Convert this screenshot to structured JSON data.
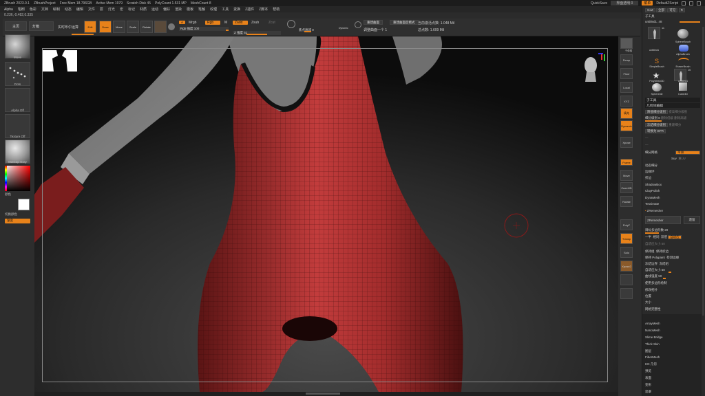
{
  "titlebar": {
    "app": "ZBrush 2023.0.1",
    "project": "ZBrushProject",
    "free_mem": "Free Mem 18.796GB",
    "active_mem": "Active Mem 1979",
    "scratch_disk": "Scratch Disk 45",
    "poly_count": "PolyCount 1.531 MP",
    "mesh_count": "MeshCount 8",
    "quicksave": "QuickSave",
    "transparency": "界面透明 0",
    "menus_btn": "菜单",
    "default_script": "DefaultZScript"
  },
  "menubar": {
    "items": [
      "Alpha",
      "笔刷",
      "色彩",
      "文档",
      "绘制",
      "动态",
      "编辑",
      "文件",
      "层",
      "灯光",
      "宏",
      "标记",
      "材质",
      "运动",
      "偏好",
      "渲染",
      "模板",
      "笔触",
      "纹理",
      "工具",
      "变换",
      "Z插件",
      "Z脚本",
      "帮助"
    ]
  },
  "infobar": {
    "text": "0.236,-0.482,0.335"
  },
  "shelf": {
    "home": "主页",
    "lightbox": "灯箱",
    "liveboolean": "实时布尔运算",
    "edit_label": "Edit",
    "draw_label": "Draw",
    "move_label": "Move",
    "scale_label": "Scale",
    "rotate_label": "Rotate",
    "a_label": "A",
    "mrgb_label": "Mrgb",
    "rgb_label": "Rgb",
    "m_label": "M",
    "zadd_label": "Zadd",
    "zsub_label": "Zsub",
    "zcut_label": "Zcut",
    "rgb_intensity": "Rgb 强度 100",
    "z_intensity": "Z 强度 51",
    "focal_shift": "焦点衰减 0",
    "draw_size": "绘制大小 8.42419",
    "dynamic": "Dynamic",
    "active_points": "当前激活点数: 1.048 Mil",
    "total_points": "总点数: 1.609 Mil",
    "curve_label": "重建曲面",
    "curve_label2": "重建曲面后模式",
    "adjust_label": "调整曲面一个 1"
  },
  "leftpanel": {
    "brush_name": "Move",
    "stroke_name": "Dots",
    "alpha_name": "Alpha Off",
    "texture_name": "Texture Off",
    "material_name": "MatCap Gray",
    "color_label": "颜色",
    "switch_color": "切换颜色",
    "gradient": "渐变"
  },
  "rightcol": {
    "items": [
      "子像素",
      "Persp",
      "Floor",
      "Local",
      "XYZ",
      "填充",
      "Dynamic",
      "Xpose",
      "Frame",
      "Move",
      "Zoom3D",
      "Rotate",
      "PolyF",
      "Transp",
      "Solo",
      "Xpose2"
    ]
  },
  "toolpanel": {
    "goz": "GoZ",
    "all": "全部",
    "visible": "可见",
    "r": "R",
    "subtool_label": "子工具",
    "current_tool": "untitled1. 48",
    "brushes": [
      {
        "name": "untitled1",
        "badge": "11"
      },
      {
        "name": "SphereBrush",
        "badge": ""
      },
      {
        "name": "AlphaBrush",
        "badge": ""
      },
      {
        "name": "SimpleBrush",
        "badge": ""
      },
      {
        "name": "EraserBrush",
        "badge": ""
      },
      {
        "name": "PolyMesh3D",
        "badge": ""
      },
      {
        "name": "untitled1",
        "badge": "16"
      },
      {
        "name": "Sphere3D",
        "badge": ""
      },
      {
        "name": "Cube3D",
        "badge": ""
      }
    ],
    "section_subtool": "子工具",
    "section_geometry": "几何体编辑",
    "divide_lower": "降低细分级别",
    "divide_higher": "提高细分级别",
    "sdiv": "细分级别 8",
    "del_lower": "删除低级",
    "del_higher": "删除高级",
    "freeze": "冻结细分级别",
    "reconstruct": "重建细分",
    "convert_bpr": "转换为 BPR",
    "divide_btn": "细分网格",
    "smt": "平滑",
    "suv": "Suv",
    "reuv": "重UV",
    "dynamic_sub": "动态细分",
    "edge_loop": "边缘环",
    "crease": "折边",
    "shadowbox": "ShadowBox",
    "claypolish": "ClayPolish",
    "dynamesh": "DynaMesh",
    "tessimate": "Tessimate",
    "zremesher": "ZRemesher",
    "zremesher_btn": "ZRemesher",
    "legacy": "遗留",
    "target_polys": "目标多边形数 20",
    "half": "一半",
    "same": "相同",
    "double": "双倍",
    "adaptive": "自适应",
    "adaptive_size": "自适应大小 50",
    "curves_strength": "曲线强度 50",
    "keep_groups": "保持组",
    "keep_creases": "保持折边",
    "detect_edges": "检测边缘",
    "keep_polypaint": "保持 Polypaint",
    "freeze_border": "冻结边界",
    "freeze_groups": "冻结组",
    "use_polypaint": "使用多边形绘制",
    "modify_topology": "修改拓扑",
    "position": "位置",
    "size": "大小",
    "mesh_integrity": "网格完整性",
    "arraymesh": "ArrayMesh",
    "nanomesh": "NanoMesh",
    "slime_bridge": "Slime Bridge",
    "thick_skin": "Thick Skin",
    "layers": "图层",
    "fibermesh": "FiberMesh",
    "hd_geometry": "HD 几何",
    "preview": "预览",
    "surface": "表面",
    "deformation": "变形",
    "masking": "遮罩"
  }
}
